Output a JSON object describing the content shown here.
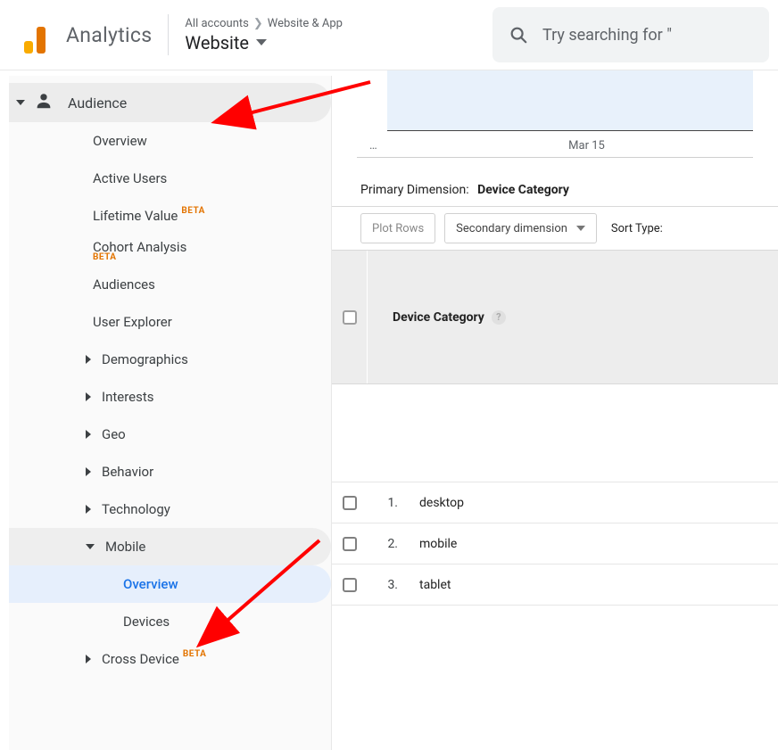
{
  "header": {
    "app_title": "Analytics",
    "breadcrumb": {
      "level1": "All accounts",
      "level2": "Website & App"
    },
    "property_name": "Website",
    "search_placeholder": "Try searching for \""
  },
  "sidebar": {
    "top": {
      "label": "Audience"
    },
    "items_flat": {
      "overview": "Overview",
      "active_users": "Active Users",
      "lifetime_value": "Lifetime Value",
      "lifetime_value_beta": "BETA",
      "cohort": "Cohort Analysis",
      "cohort_beta": "BETA",
      "audiences": "Audiences",
      "user_explorer": "User Explorer",
      "demographics": "Demographics",
      "interests": "Interests",
      "geo": "Geo",
      "behavior": "Behavior",
      "technology": "Technology",
      "mobile": "Mobile",
      "mobile_overview": "Overview",
      "mobile_devices": "Devices",
      "cross_device": "Cross Device",
      "cross_device_beta": "BETA"
    }
  },
  "chart": {
    "ellipsis": "…",
    "tick_mar15": "Mar 15"
  },
  "dim": {
    "label": "Primary Dimension:",
    "value": "Device Category"
  },
  "toolbar": {
    "plot_rows": "Plot Rows",
    "secondary_dim": "Secondary dimension",
    "sort_type": "Sort Type:"
  },
  "table": {
    "col_header": "Device Category",
    "rows": [
      {
        "n": "1.",
        "v": "desktop"
      },
      {
        "n": "2.",
        "v": "mobile"
      },
      {
        "n": "3.",
        "v": "tablet"
      }
    ]
  }
}
